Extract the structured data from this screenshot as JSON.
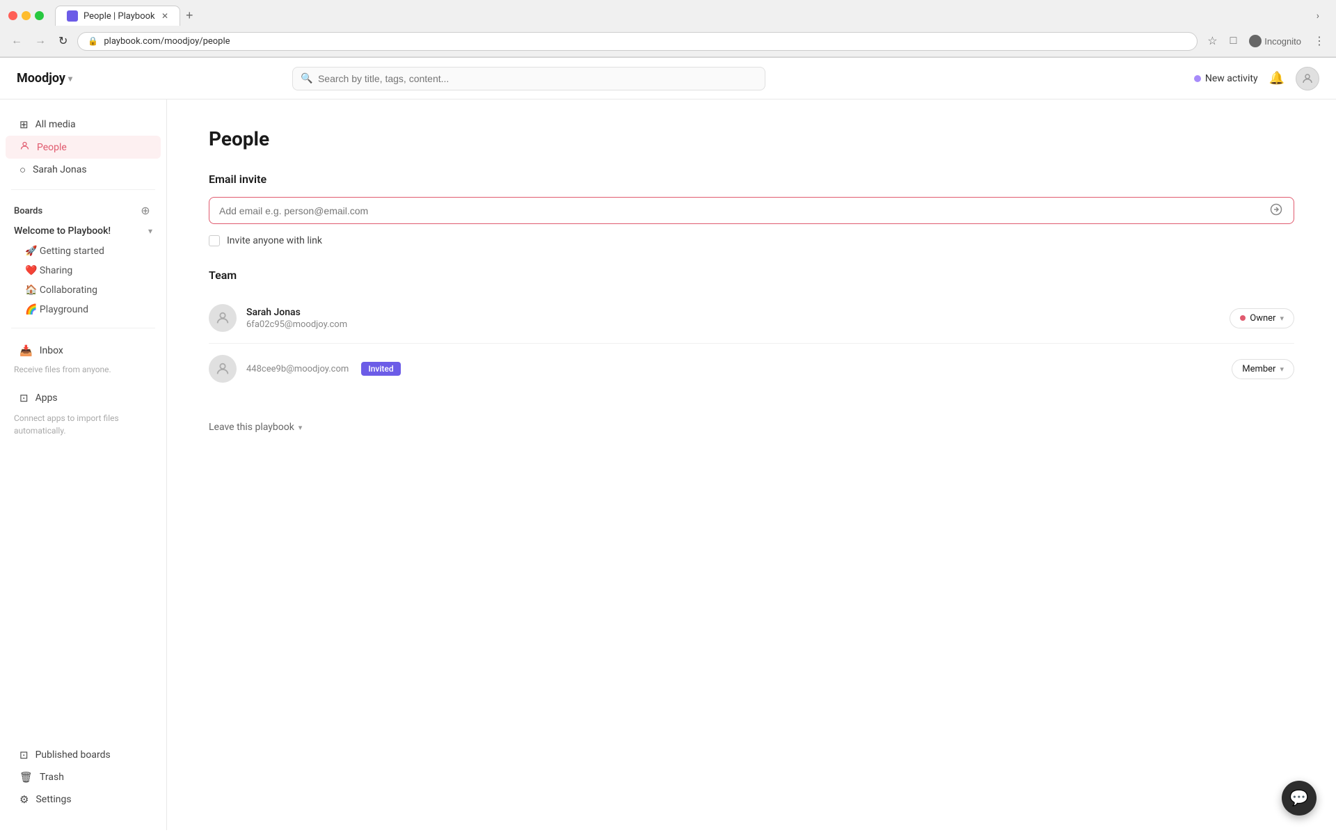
{
  "browser": {
    "tab_title": "People | Playbook",
    "url": "playbook.com/moodjoy/people",
    "back_btn": "←",
    "forward_btn": "→",
    "reload_btn": "↻",
    "lock_icon": "🔒",
    "star_icon": "☆",
    "extensions_icon": "□",
    "account_label": "Incognito",
    "menu_icon": "⋮",
    "new_tab_icon": "+",
    "chevron_icon": "›"
  },
  "header": {
    "logo": "Moodjoy",
    "logo_chevron": "▾",
    "search_placeholder": "Search by title, tags, content...",
    "new_activity_label": "New activity",
    "bell_icon": "🔔"
  },
  "sidebar": {
    "all_media_label": "All media",
    "people_label": "People",
    "sarah_jonas_label": "Sarah Jonas",
    "boards_label": "Boards",
    "playbook_label": "Welcome to Playbook!",
    "getting_started_label": "🚀 Getting started",
    "sharing_label": "❤️ Sharing",
    "collaborating_label": "🏠 Collaborating",
    "playground_label": "🌈 Playground",
    "inbox_label": "Inbox",
    "inbox_sub_label": "Receive files from anyone.",
    "apps_label": "Apps",
    "apps_sub_label": "Connect apps to import files automatically.",
    "published_boards_label": "Published boards",
    "trash_label": "Trash",
    "settings_label": "Settings"
  },
  "main": {
    "page_title": "People",
    "email_invite_section": "Email invite",
    "email_placeholder": "Add email e.g. person@email.com",
    "invite_link_label": "Invite anyone with link",
    "team_section": "Team",
    "team_members": [
      {
        "name": "Sarah Jonas",
        "email": "6fa02c95@moodjoy.com",
        "role": "Owner",
        "is_owner": true,
        "invited": false
      },
      {
        "name": "",
        "email": "448cee9b@moodjoy.com",
        "role": "Member",
        "is_owner": false,
        "invited": true
      }
    ],
    "leave_playbook_label": "Leave this playbook"
  },
  "icons": {
    "grid": "⊞",
    "person": "👤",
    "circle": "○",
    "add": "+",
    "inbox": "📥",
    "grid_small": "⊡",
    "trash": "🗑",
    "gear": "⚙",
    "send": "➤",
    "chat": "💬"
  }
}
